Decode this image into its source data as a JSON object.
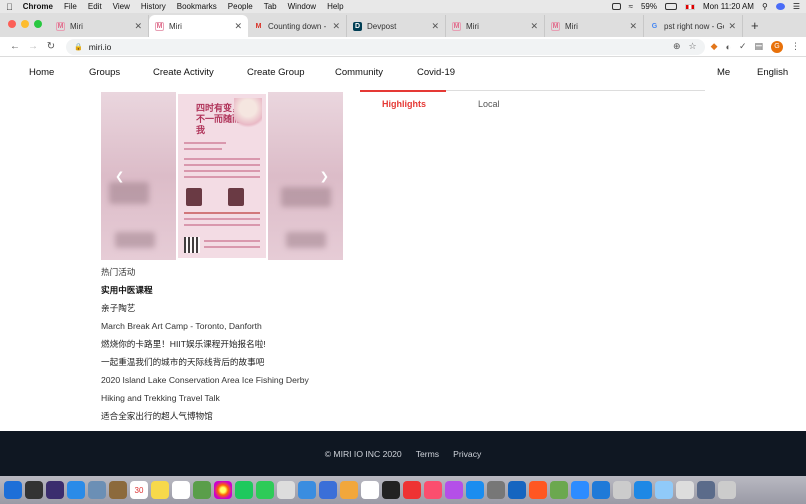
{
  "menubar": {
    "app": "Chrome",
    "items": [
      "File",
      "Edit",
      "View",
      "History",
      "Bookmarks",
      "People",
      "Tab",
      "Window",
      "Help"
    ],
    "battery": "59%",
    "clock": "Mon 11:20 AM"
  },
  "browser": {
    "tabs": [
      {
        "title": "Miri",
        "favicon": "miri-icon"
      },
      {
        "title": "Miri",
        "favicon": "miri-icon",
        "active": true
      },
      {
        "title": "Counting down - CO",
        "favicon": "gmail-icon"
      },
      {
        "title": "Devpost",
        "favicon": "devpost-icon"
      },
      {
        "title": "Miri",
        "favicon": "miri-icon"
      },
      {
        "title": "Miri",
        "favicon": "miri-icon"
      },
      {
        "title": "pst right now - Goog",
        "favicon": "google-icon"
      }
    ],
    "url": "miri.io",
    "profile_initial": "G"
  },
  "sitenav": {
    "items": [
      "Home",
      "Groups",
      "Create Activity",
      "Create Group",
      "Community",
      "Covid-19"
    ],
    "me": "Me",
    "lang": "English"
  },
  "tabs": {
    "highlights": "Highlights",
    "local": "Local"
  },
  "activities": {
    "heading": "热门活动",
    "items": [
      {
        "label": "实用中医课程",
        "bold": true
      },
      {
        "label": "亲子陶艺",
        "bold": false
      },
      {
        "label": "March Break Art Camp - Toronto, Danforth",
        "bold": false
      },
      {
        "label": "燃烧你的卡路里！HIIT娱乐课程开始报名啦!",
        "bold": false
      },
      {
        "label": "一起重温我们的城市的天际线背后的故事吧",
        "bold": false
      },
      {
        "label": "2020 Island Lake Conservation Area Ice Fishing Derby",
        "bold": false
      },
      {
        "label": "Hiking and Trekking Travel Talk",
        "bold": false
      },
      {
        "label": "适合全家出行的超人气博物馆",
        "bold": false
      }
    ]
  },
  "poster": {
    "title": "四时有变，不一而随而我"
  },
  "footer": {
    "copyright": "© MIRI IO INC 2020",
    "terms": "Terms",
    "privacy": "Privacy"
  }
}
